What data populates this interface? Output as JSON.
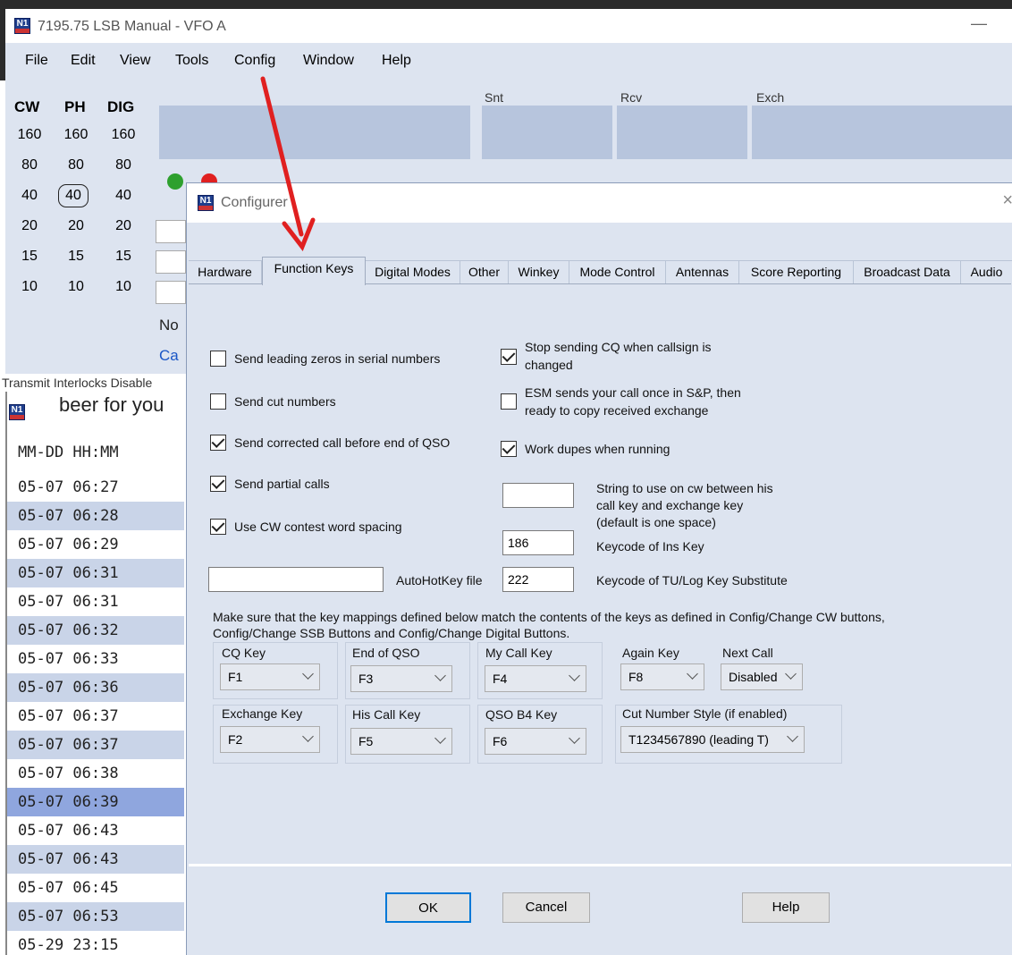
{
  "main_window": {
    "title": "7195.75 LSB Manual - VFO A",
    "minimize": "—",
    "menu": [
      "File",
      "Edit",
      "View",
      "Tools",
      "Config",
      "Window",
      "Help"
    ],
    "band_columns": [
      "CW",
      "PH",
      "DIG"
    ],
    "band_rows": [
      [
        "160",
        "160",
        "160"
      ],
      [
        "80",
        "80",
        "80"
      ],
      [
        "40",
        "40",
        "40"
      ],
      [
        "20",
        "20",
        "20"
      ],
      [
        "15",
        "15",
        "15"
      ],
      [
        "10",
        "10",
        "10"
      ]
    ],
    "selected_band": "40",
    "field_labels": {
      "snt": "Snt",
      "rcv": "Rcv",
      "exch": "Exch"
    },
    "side_text_no": "No",
    "side_text_ca": "Ca",
    "interlock_status": "Transmit Interlocks Disable",
    "log_banner": "beer for you",
    "log_column_header": "MM-DD HH:MM",
    "log_rows": [
      "05-07 06:27",
      "05-07 06:28",
      "05-07 06:29",
      "05-07 06:31",
      "05-07 06:31",
      "05-07 06:32",
      "05-07 06:33",
      "05-07 06:36",
      "05-07 06:37",
      "05-07 06:37",
      "05-07 06:38",
      "05-07 06:39",
      "05-07 06:43",
      "05-07 06:43",
      "05-07 06:45",
      "05-07 06:53",
      "05-29 23:15"
    ],
    "selected_log_row": "05-07 06:39"
  },
  "dialog": {
    "title": "Configurer",
    "close": "×",
    "tabs": [
      "Hardware",
      "Function Keys",
      "Digital Modes",
      "Other",
      "Winkey",
      "Mode Control",
      "Antennas",
      "Score Reporting",
      "Broadcast Data",
      "Audio"
    ],
    "active_tab": "Function Keys",
    "options_left": {
      "leading_zeros": {
        "label": "Send leading zeros in serial numbers",
        "checked": false
      },
      "cut_numbers": {
        "label": "Send cut numbers",
        "checked": false
      },
      "corrected_call": {
        "label": "Send corrected call before end of QSO",
        "checked": true
      },
      "partial_calls": {
        "label": "Send partial calls",
        "checked": true
      },
      "cw_word_spacing": {
        "label": "Use CW contest word spacing",
        "checked": true
      }
    },
    "options_right": {
      "stop_cq": {
        "label_1": "Stop sending CQ when callsign is",
        "label_2": "changed",
        "checked": true
      },
      "esm": {
        "label_1": "ESM sends your call once in S&P, then",
        "label_2": "ready to copy received exchange",
        "checked": false
      },
      "work_dupes": {
        "label": "Work dupes when running",
        "checked": true
      }
    },
    "cw_string": {
      "value": "",
      "label_1": "String to use on cw between his",
      "label_2": "call key and exchange key",
      "label_3": "(default is one space)"
    },
    "ins_keycode": {
      "value": "186",
      "label": "Keycode of Ins Key"
    },
    "autohotkey": {
      "value": "",
      "label": "AutoHotKey file"
    },
    "tu_keycode": {
      "value": "222",
      "label": "Keycode of TU/Log Key Substitute"
    },
    "mapping_note_1": "Make sure that the key mappings defined below match the contents of the keys as defined in Config/Change CW buttons,",
    "mapping_note_2": "Config/Change SSB Buttons and Config/Change Digital Buttons.",
    "keys": {
      "cq": {
        "label": "CQ Key",
        "value": "F1"
      },
      "end_qso": {
        "label": "End of QSO",
        "value": "F3"
      },
      "my_call": {
        "label": "My Call Key",
        "value": "F4"
      },
      "again": {
        "label": "Again  Key",
        "value": "F8"
      },
      "next_call": {
        "label": "Next Call",
        "value": "Disabled"
      },
      "exchange": {
        "label": "Exchange  Key",
        "value": "F2"
      },
      "his_call": {
        "label": "His Call Key",
        "value": "F5"
      },
      "qso_b4": {
        "label": "QSO B4 Key",
        "value": "F6"
      },
      "cut_style": {
        "label": "Cut Number Style (if enabled)",
        "value": "T1234567890 (leading T)"
      }
    },
    "buttons": {
      "ok": "OK",
      "cancel": "Cancel",
      "help": "Help"
    }
  },
  "colors": {
    "panel_bg": "#dde4f0",
    "field_bg": "#b7c5dd",
    "log_alt_row": "#c9d4e8",
    "log_selected_row": "#8fa6de",
    "annotation_arrow": "#e02020",
    "led_green": "#2ea02e",
    "led_red": "#e02020"
  }
}
